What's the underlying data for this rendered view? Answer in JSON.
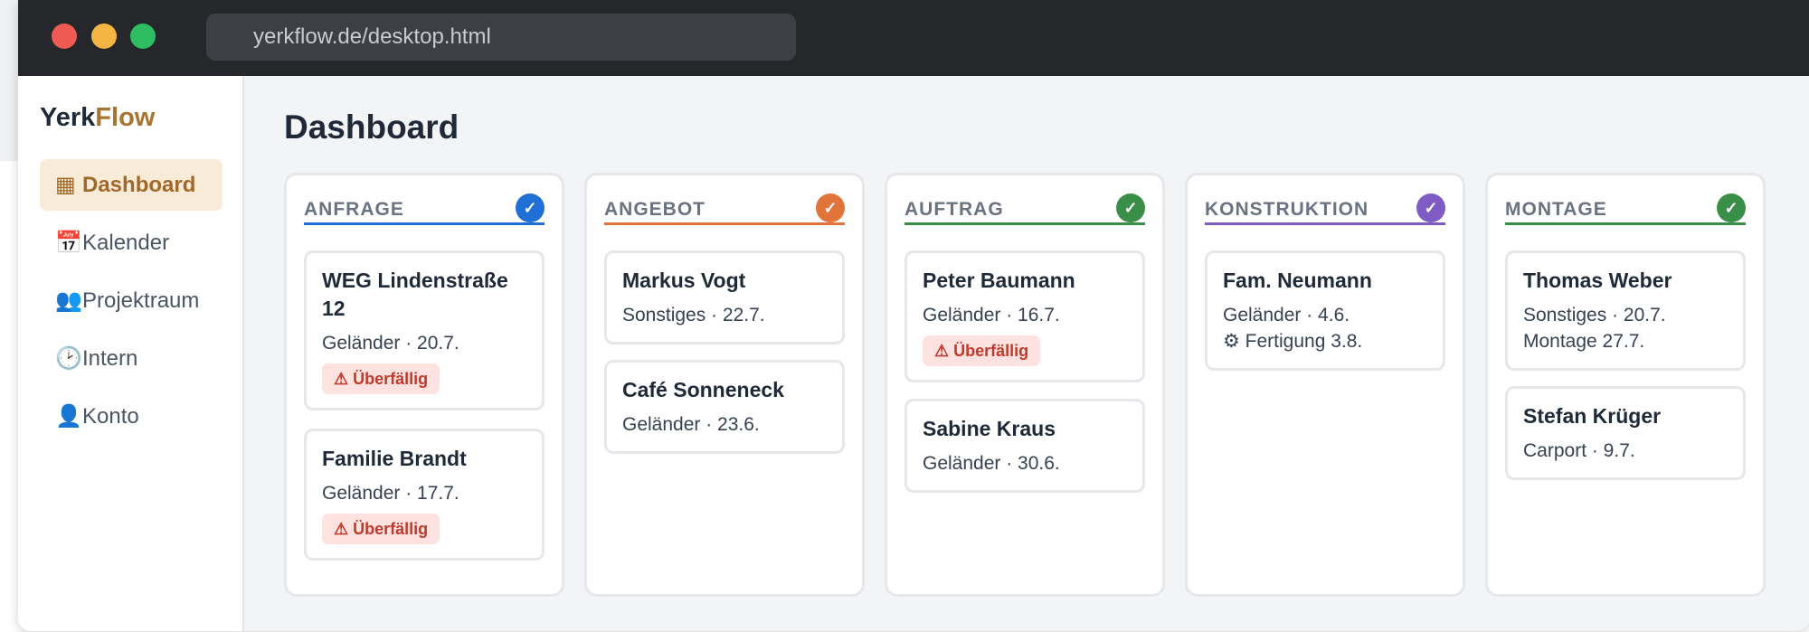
{
  "browser": {
    "url": "yerkflow.de/desktop.html"
  },
  "app": {
    "logo_part1": "Yerk",
    "logo_part2": "Flow"
  },
  "sidebar": {
    "items": [
      {
        "icon": "▦",
        "label": "Dashboard"
      },
      {
        "icon": "📅",
        "label": "Kalender"
      },
      {
        "icon": "👥",
        "label": "Projektraum"
      },
      {
        "icon": "🕑",
        "label": "Intern"
      },
      {
        "icon": "👤",
        "label": "Konto"
      }
    ]
  },
  "page": {
    "title": "Dashboard"
  },
  "columns": [
    {
      "title": "ANFRAGE",
      "check": "✓",
      "color": "#1f6fd6",
      "cards": [
        {
          "name": "WEG Lindenstraße 12",
          "meta": "Geländer · 20.7.",
          "badge": "⚠ Überfällig"
        },
        {
          "name": "Familie Brandt",
          "meta": "Geländer · 17.7.",
          "badge": "⚠ Überfällig"
        }
      ]
    },
    {
      "title": "ANGEBOT",
      "check": "✓",
      "color": "#e0743a",
      "cards": [
        {
          "name": "Markus Vogt",
          "meta": "Sonstiges · 22.7."
        },
        {
          "name": "Café Sonneneck",
          "meta": "Geländer · 23.6."
        }
      ]
    },
    {
      "title": "AUFTRAG",
      "check": "✓",
      "color": "#3a8f48",
      "cards": [
        {
          "name": "Peter Baumann",
          "meta": "Geländer · 16.7.",
          "badge": "⚠ Überfällig"
        },
        {
          "name": "Sabine Kraus",
          "meta": "Geländer · 30.6."
        }
      ]
    },
    {
      "title": "KONSTRUKTION",
      "check": "✓",
      "color": "#7e5cc4",
      "cards": [
        {
          "name": "Fam. Neumann",
          "meta": "Geländer · 4.6.",
          "extra": "⚙ Fertigung 3.8."
        }
      ]
    },
    {
      "title": "MONTAGE",
      "check": "✓",
      "color": "#3a8f48",
      "cards": [
        {
          "name": "Thomas Weber",
          "meta": "Sonstiges · 20.7.",
          "extra": "Montage 27.7."
        },
        {
          "name": "Stefan Krüger",
          "meta": "Carport · 9.7."
        }
      ]
    }
  ]
}
